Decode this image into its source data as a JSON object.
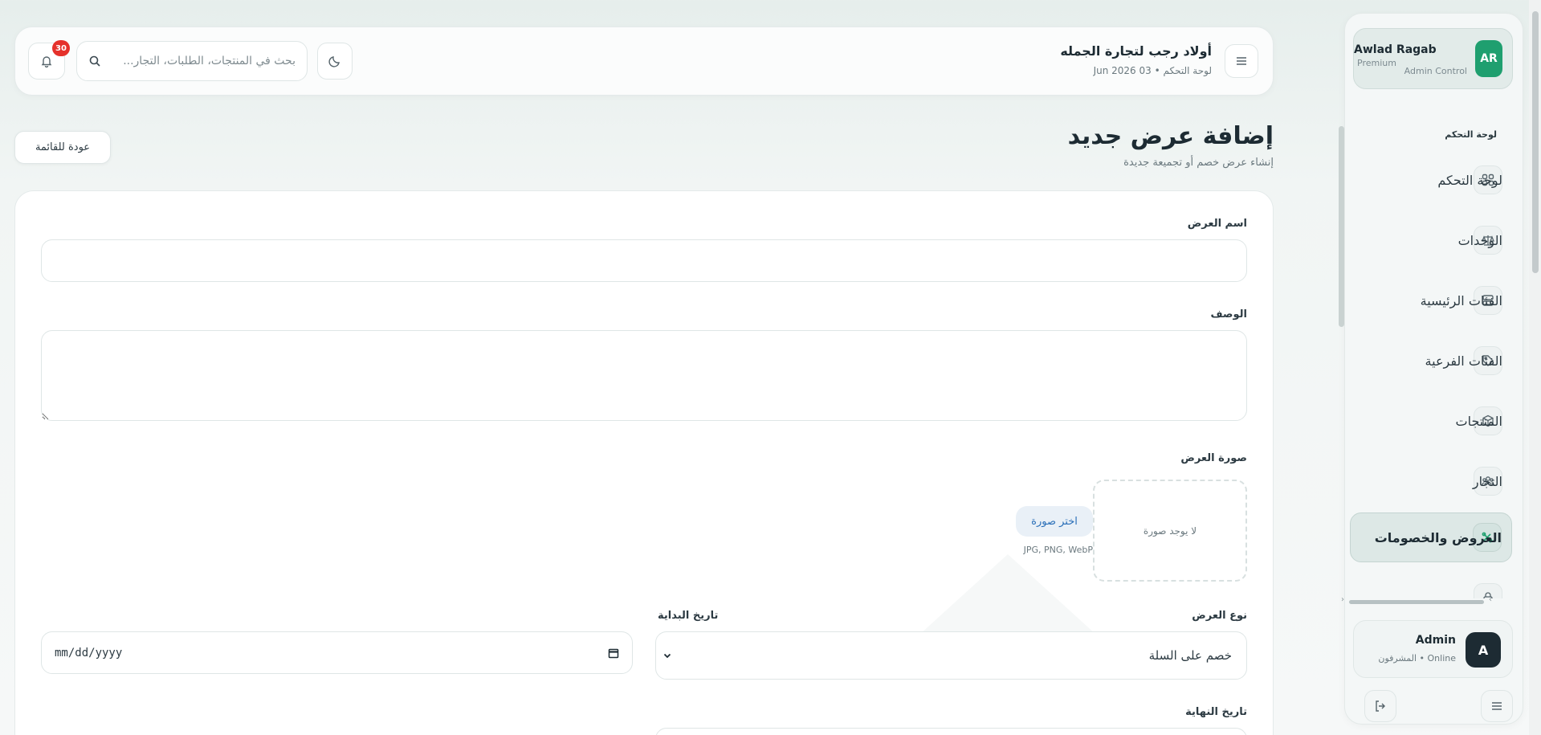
{
  "sidebar": {
    "profile": {
      "initials": "AR",
      "name": "Awlad Ragab",
      "tier": "Premium",
      "role": "Admin Control"
    },
    "section_label": "لوحة التحكم",
    "items": [
      {
        "label": "لوحة التحكم",
        "icon": "grid-icon"
      },
      {
        "label": "الوحدات",
        "icon": "scale-icon"
      },
      {
        "label": "الفئات الرئيسية",
        "icon": "rows-icon"
      },
      {
        "label": "الفئات الفرعية",
        "icon": "tag-icon"
      },
      {
        "label": "المنتجات",
        "icon": "box-icon"
      },
      {
        "label": "التجار",
        "icon": "users-icon"
      },
      {
        "label": "العروض والخصومات",
        "icon": "discount-icon",
        "active": true
      }
    ],
    "admin": {
      "initial": "A",
      "name": "Admin",
      "status": "Online • المشرفون"
    }
  },
  "header": {
    "title": "أولاد رجب لتجارة الجمله",
    "subtitle": "لوحة التحكم • 03 Jun 2026",
    "search_placeholder": "بحث في المنتجات، الطلبات، التجار...",
    "notifications": "30"
  },
  "page": {
    "title": "إضافة عرض جديد",
    "subtitle": "إنشاء عرض خصم أو تجميعة جديدة",
    "back_label": "عودة للقائمة"
  },
  "form": {
    "name_label": "اسم العرض",
    "name_value": "",
    "desc_label": "الوصف",
    "desc_value": "",
    "image_label": "صورة العرض",
    "no_image": "لا يوجد صورة",
    "pick_image": "اختر صورة",
    "formats": "JPG, PNG, WebP",
    "type_label": "نوع العرض",
    "type_value": "خصم على السلة",
    "start_label": "تاريخ البداية",
    "start_placeholder": "mm/dd/yyyy",
    "end_label": "تاريخ النهاية"
  },
  "colors": {
    "accent": "#1f9f6f",
    "badge": "#e5312b",
    "link": "#2a6fb8"
  }
}
